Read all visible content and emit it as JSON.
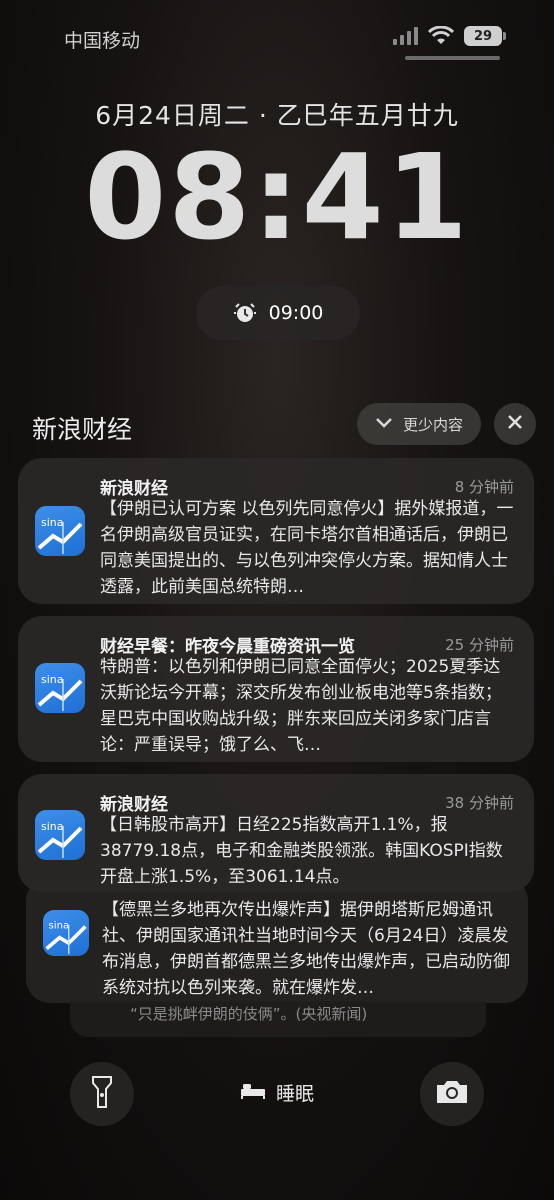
{
  "status": {
    "carrier": "中国移动",
    "battery": "29"
  },
  "lock": {
    "date": "6月24日周二 · 乙巳年五月廿九",
    "time": "08:41",
    "alarm": "09:00"
  },
  "group": {
    "title": "新浪财经",
    "less_label": "更少内容"
  },
  "notifications": [
    {
      "title": "新浪财经",
      "time": "8 分钟前",
      "body": "【伊朗已认可方案 以色列先同意停火】据外媒报道，一名伊朗高级官员证实，在同卡塔尔首相通话后，伊朗已同意美国提出的、与以色列冲突停火方案。据知情人士透露，此前美国总统特朗…"
    },
    {
      "title": "财经早餐：昨夜今晨重磅资讯一览",
      "time": "25 分钟前",
      "body": "特朗普：以色列和伊朗已同意全面停火；2025夏季达沃斯论坛今开幕；深交所发布创业板电池等5条指数；星巴克中国收购战升级；胖东来回应关闭多家门店言论：严重误导；饿了么、飞…"
    },
    {
      "title": "新浪财经",
      "time": "38 分钟前",
      "body": "【日韩股市高开】日经225指数高开1.1%，报38779.18点，电子和金融类股领涨。韩国KOSPI指数开盘上涨1.5%，至3061.14点。"
    },
    {
      "title": "",
      "time": "",
      "body": "【德黑兰多地再次传出爆炸声】据伊朗塔斯尼姆通讯社、伊朗国家通讯社当地时间今天（6月24日）凌晨发布消息，伊朗首都德黑兰多地传出爆炸声，已启动防御系统对抗以色列来袭。就在爆炸发…"
    }
  ],
  "peek": "“只是挑衅伊朗的伎俩”。(央视新闻)",
  "bottom": {
    "sleep_label": "睡眠"
  },
  "icons": {
    "flashlight": "flashlight-icon",
    "camera": "camera-icon",
    "bed": "bed-icon",
    "alarm": "alarm-icon",
    "app": "sina-finance-icon"
  }
}
